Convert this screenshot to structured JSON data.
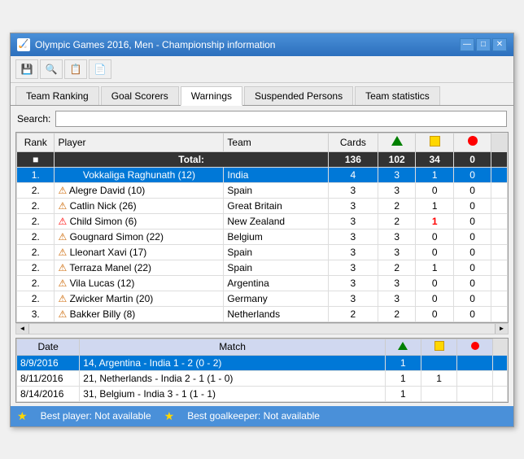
{
  "window": {
    "title": "Olympic Games 2016, Men - Championship information",
    "icon": "🏅"
  },
  "title_buttons": [
    "—",
    "□",
    "✕"
  ],
  "toolbar_buttons": [
    "💾",
    "🔍",
    "📋",
    "📄"
  ],
  "tabs": [
    {
      "label": "Team Ranking",
      "active": false
    },
    {
      "label": "Goal Scorers",
      "active": false
    },
    {
      "label": "Warnings",
      "active": true
    },
    {
      "label": "Suspended Persons",
      "active": false
    },
    {
      "label": "Team statistics",
      "active": false
    }
  ],
  "search": {
    "label": "Search:",
    "placeholder": "",
    "value": ""
  },
  "table": {
    "headers": [
      "Rank",
      "Player",
      "Team",
      "Cards",
      "▲",
      "■",
      "●"
    ],
    "total_row": {
      "label": "Total:",
      "cards": "136",
      "green": "102",
      "yellow": "34",
      "red": "0"
    },
    "rows": [
      {
        "rank": "1.",
        "player": "Vokkaliga Raghunath (12)",
        "team": "India",
        "cards": "4",
        "green": "3",
        "yellow": "1",
        "red": "0",
        "highlight": true,
        "icon": ""
      },
      {
        "rank": "2.",
        "player": "Alegre David (10)",
        "team": "Spain",
        "cards": "3",
        "green": "3",
        "yellow": "0",
        "red": "0",
        "highlight": false,
        "icon": "⚠"
      },
      {
        "rank": "2.",
        "player": "Catlin Nick (26)",
        "team": "Great Britain",
        "cards": "3",
        "green": "2",
        "yellow": "1",
        "red": "0",
        "highlight": false,
        "icon": "⚠"
      },
      {
        "rank": "2.",
        "player": "Child Simon (6)",
        "team": "New Zealand",
        "cards": "3",
        "green": "2",
        "yellow": "1",
        "red": "0",
        "highlight": false,
        "icon": "⚠"
      },
      {
        "rank": "2.",
        "player": "Gougnard Simon (22)",
        "team": "Belgium",
        "cards": "3",
        "green": "3",
        "yellow": "0",
        "red": "0",
        "highlight": false,
        "icon": "⚠"
      },
      {
        "rank": "2.",
        "player": "Lleonart Xavi (17)",
        "team": "Spain",
        "cards": "3",
        "green": "3",
        "yellow": "0",
        "red": "0",
        "highlight": false,
        "icon": "⚠"
      },
      {
        "rank": "2.",
        "player": "Terraza Manel (22)",
        "team": "Spain",
        "cards": "3",
        "green": "2",
        "yellow": "1",
        "red": "0",
        "highlight": false,
        "icon": "⚠"
      },
      {
        "rank": "2.",
        "player": "Vila Lucas (12)",
        "team": "Argentina",
        "cards": "3",
        "green": "3",
        "yellow": "0",
        "red": "0",
        "highlight": false,
        "icon": "⚠"
      },
      {
        "rank": "2.",
        "player": "Zwicker Martin (20)",
        "team": "Germany",
        "cards": "3",
        "green": "3",
        "yellow": "0",
        "red": "0",
        "highlight": false,
        "icon": "⚠"
      },
      {
        "rank": "3.",
        "player": "Bakker Billy (8)",
        "team": "Netherlands",
        "cards": "2",
        "green": "2",
        "yellow": "0",
        "red": "0",
        "highlight": false,
        "icon": "⚠"
      }
    ]
  },
  "bottom_table": {
    "headers": [
      "Date",
      "Match",
      "▲",
      "■",
      "●"
    ],
    "rows": [
      {
        "date": "8/9/2016",
        "match": "14, Argentina - India 1 - 2 (0 - 2)",
        "green": "1",
        "yellow": "",
        "red": "",
        "highlight": true
      },
      {
        "date": "8/11/2016",
        "match": "21, Netherlands - India 2 - 1 (1 - 0)",
        "green": "1",
        "yellow": "1",
        "red": "",
        "highlight": false
      },
      {
        "date": "8/14/2016",
        "match": "31, Belgium - India 3 - 1 (1 - 1)",
        "green": "1",
        "yellow": "",
        "red": "",
        "highlight": false
      }
    ]
  },
  "status_bar": {
    "best_player": "Best player: Not available",
    "best_goalkeeper": "Best goalkeeper: Not available"
  }
}
